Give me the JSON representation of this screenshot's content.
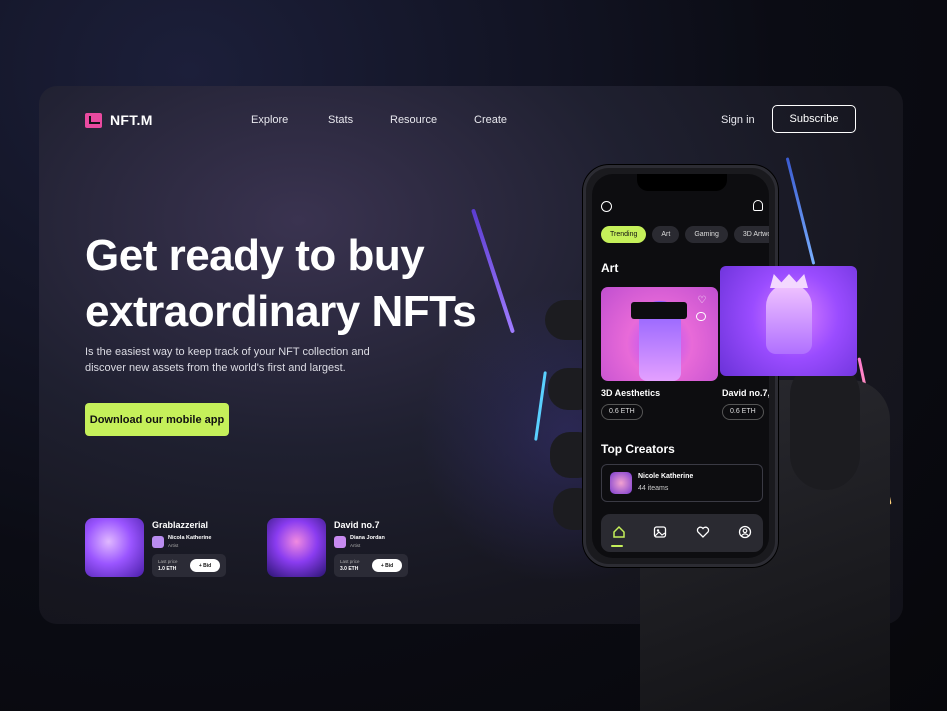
{
  "brand": {
    "name": "NFT.M",
    "color": "#e94aa0"
  },
  "nav": {
    "items": [
      {
        "label": "Explore"
      },
      {
        "label": "Stats"
      },
      {
        "label": "Resource"
      },
      {
        "label": "Create"
      }
    ],
    "signin": "Sign in",
    "subscribe": "Subscribe"
  },
  "hero": {
    "title_line1": "Get ready to buy",
    "title_line2": "extraordinary NFTs",
    "subtitle": "Is the easiest way to keep track of your NFT collection and discover new assets from the world's first and largest.",
    "cta": "Download our mobile app",
    "accent": "#c5f05a"
  },
  "featured": [
    {
      "title": "Grablazzerial",
      "creator": "Nicola Katherine",
      "role": "Artist",
      "price_label": "Last price",
      "price": "1.0 ETH",
      "bid": "+ Bid"
    },
    {
      "title": "David no.7",
      "creator": "Diana Jordan",
      "role": "Artist",
      "price_label": "Last price",
      "price": "3.0 ETH",
      "bid": "+ Bid"
    }
  ],
  "phone": {
    "chips": [
      "Trending",
      "Art",
      "Gaming",
      "3D Artwo"
    ],
    "section_art": "Art",
    "cards": [
      {
        "name": "3D Aesthetics",
        "price": "0.6 ETH"
      },
      {
        "name": "David no.7,",
        "price": "0.6 ETH"
      }
    ],
    "section_creators": "Top Creators",
    "creator": {
      "name": "Nicole Katherine",
      "items": "44 iteams"
    },
    "tabs": [
      "home-icon",
      "gallery-icon",
      "heart-icon",
      "profile-icon"
    ]
  }
}
